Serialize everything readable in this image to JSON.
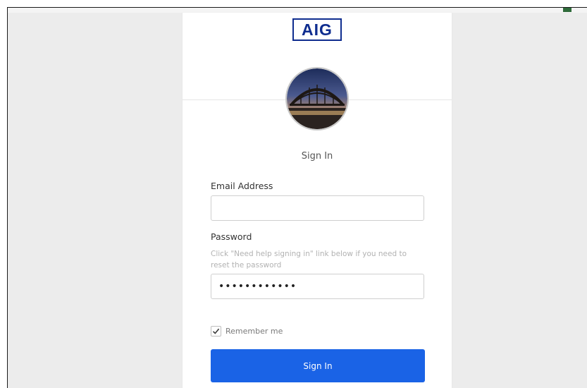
{
  "logo": {
    "text": "AIG"
  },
  "login": {
    "title": "Sign In",
    "email": {
      "label": "Email Address",
      "value": "",
      "placeholder": ""
    },
    "password": {
      "label": "Password",
      "hint": "Click \"Need help signing in\" link below if you need to reset the password",
      "value": "••••••••••••",
      "placeholder": ""
    },
    "remember": {
      "label": "Remember me",
      "checked": true
    },
    "submit_label": "Sign In"
  },
  "colors": {
    "brand_blue": "#0f2d8f",
    "button_blue": "#1a63e6",
    "page_bg": "#ececec"
  },
  "icons": {
    "avatar": "bridge-photo-icon",
    "checkbox": "check-icon"
  }
}
